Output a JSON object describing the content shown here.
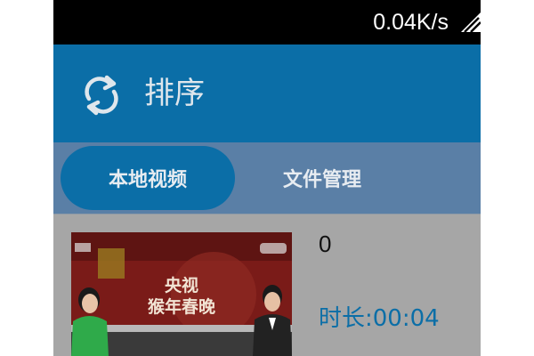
{
  "status_bar": {
    "network_speed": "0.04K/s",
    "signal_icon": "signal-strength-icon"
  },
  "app_bar": {
    "icon": "refresh-icon",
    "title": "排序"
  },
  "tabs": [
    {
      "label": "本地视频",
      "active": true
    },
    {
      "label": "文件管理",
      "active": false
    }
  ],
  "videos": [
    {
      "name": "0",
      "duration": "时长:00:04",
      "thumbnail_caption": "央视 猴年春晚"
    }
  ],
  "colors": {
    "status_bar": "#000000",
    "app_bar": "#0b6ea7",
    "tab_bar": "#5a7fa6",
    "active_tab": "#0b6ea7",
    "list_background": "#a6a6a6",
    "duration_text": "#0b6ea7"
  }
}
